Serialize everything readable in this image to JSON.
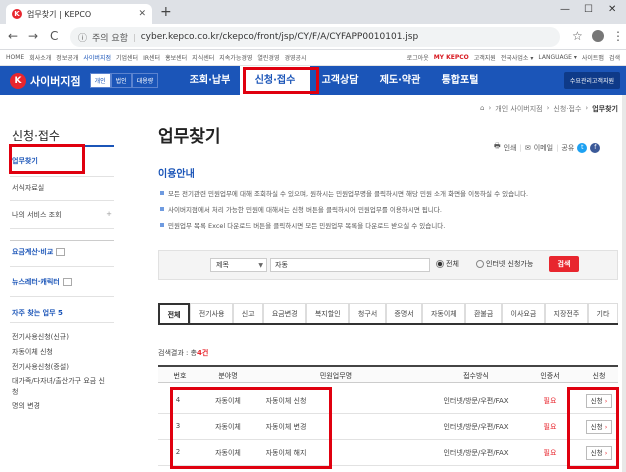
{
  "browser": {
    "tab_title": "업무찾기 | KEPCO",
    "new_tab": "+",
    "minimize": "—",
    "maximize": "☐",
    "close": "✕",
    "back": "←",
    "forward": "→",
    "reload": "C",
    "secure_label": "주의 요함",
    "url": "cyber.kepco.co.kr/ckepco/front/jsp/CY/F/A/CYFAPP0010101.jsp",
    "star": "☆",
    "menu": "⋮"
  },
  "utility": {
    "left": [
      "HOME",
      "회사소개",
      "정보공개",
      "사이버지점",
      "기업센터",
      "IR센터",
      "홍보센터",
      "지식센터",
      "지속가능경영",
      "열린경영",
      "경영공시"
    ],
    "right": [
      "로그아웃",
      "MY KEPCO",
      "고객지원",
      "전국사업소 ▾",
      "LANGUAGE ▾",
      "사이트맵",
      "검색"
    ]
  },
  "gnb": {
    "logo_mark": "K",
    "logo_text": "사이버지점",
    "customer_types": [
      "개인",
      "법인",
      "대용량"
    ],
    "menu": [
      "조회·납부",
      "신청·접수",
      "고객상담",
      "제도·약관",
      "통합포털"
    ],
    "right_button": "수요관리고객지원"
  },
  "breadcrumb": [
    "⌂",
    "›",
    "개인 사이버지점",
    "›",
    "신청·접수",
    "›",
    "업무찾기"
  ],
  "sidebar": {
    "title": "신청·접수",
    "items": [
      "업무찾기",
      "서식자료실",
      "나의 서비스 조회"
    ],
    "plus": "+",
    "links": [
      "요금계산·비교",
      "뉴스레터·캐릭터"
    ],
    "favorites_title": "자주 찾는 업무 5",
    "favorites": [
      "전기사용신청(신규)",
      "자동이체 신청",
      "전기사용신청(증설)",
      "대가족/다자녀/출산가구 요금 신청",
      "명의 변경"
    ]
  },
  "main": {
    "title": "업무찾기",
    "share": {
      "print": "인쇄",
      "email": "이메일",
      "share": "공유"
    },
    "guide_title": "이용안내",
    "guide": [
      "모든 전기관련 민원업무에 대해 조회하실 수 있으며, 원하시는 민원업무명을 클릭하시면 해당 민원 소개 화면을 이동하실 수 있습니다.",
      "사이버지점에서 처리 가능한 민원에 대해서는 신청 버튼을 클릭하시어 민원업무를 이용하시면 됩니다.",
      "민원업무 목록 Excel 다운로드 버튼을 클릭하시면 모든 민원업무 목록을 다운로드 받으실 수 있습니다."
    ],
    "search": {
      "select_value": "제목",
      "input_value": "자동",
      "radio_all": "전체",
      "radio_cyber": "인터넷 신청가능",
      "button": "검색"
    },
    "categories": [
      "전체",
      "전기사용",
      "신고",
      "요금변경",
      "복지할인",
      "청구서",
      "증명서",
      "자동이체",
      "환불금",
      "이사요금",
      "지장전주",
      "기타"
    ],
    "result_prefix": "검색결과 : 총",
    "result_count": "4건",
    "columns": [
      "번호",
      "분야명",
      "민원업무명",
      "접수방식",
      "인증서",
      "신청"
    ],
    "rows": [
      {
        "no": "4",
        "field": "자동이체",
        "name": "자동이체 신청",
        "method": "인터넷/방문/우편/FAX",
        "cert": "필요",
        "apply": "신청"
      },
      {
        "no": "3",
        "field": "자동이체",
        "name": "자동이체 변경",
        "method": "인터넷/방문/우편/FAX",
        "cert": "필요",
        "apply": "신청"
      },
      {
        "no": "2",
        "field": "자동이체",
        "name": "자동이체 해지",
        "method": "인터넷/방문/우편/FAX",
        "cert": "필요",
        "apply": "신청"
      }
    ],
    "apply_arrow": "›"
  }
}
